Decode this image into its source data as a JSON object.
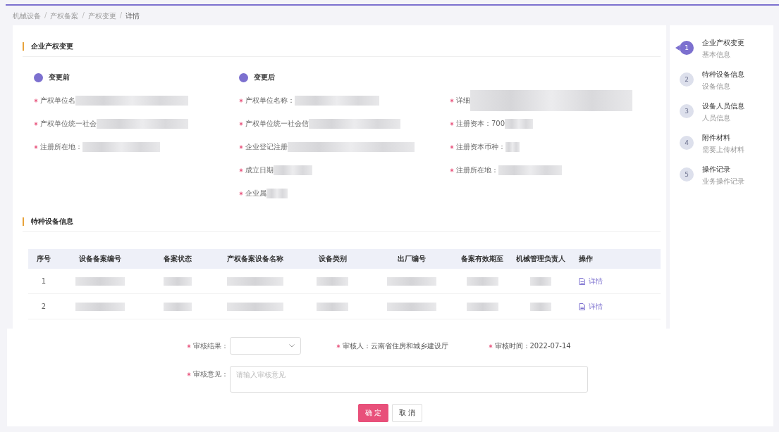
{
  "breadcrumb": [
    {
      "label": "机械设备",
      "current": false
    },
    {
      "separator": "/",
      "label": "产权备案",
      "current": false
    },
    {
      "separator": "/",
      "label": "产权变更",
      "current": false
    },
    {
      "separator": "/",
      "label": "详情",
      "current": true
    }
  ],
  "ownership_section": {
    "title": "企业产权变更",
    "before": {
      "title": "变更前",
      "fields": [
        {
          "label": "产权单位名",
          "required": true
        },
        {
          "label": "产权单位统一社会",
          "required": true
        },
        {
          "label": "注册所在地：",
          "required": true
        }
      ]
    },
    "after": {
      "title": "变更后",
      "fields": [
        {
          "label": "产权单位名称：",
          "required": true
        },
        {
          "label": "产权单位统一社会信",
          "required": true
        },
        {
          "label": "企业登记注册",
          "required": true
        },
        {
          "label": "成立日期",
          "required": true
        },
        {
          "label": "企业属",
          "required": true
        }
      ]
    },
    "after_more": {
      "fields": [
        {
          "label": "详细",
          "required": true
        },
        {
          "label": "注册资本：700",
          "required": true
        },
        {
          "label": "注册资本币种：",
          "required": true
        },
        {
          "label": "注册所在地：",
          "required": true
        }
      ]
    }
  },
  "equipment_section": {
    "title": "特种设备信息",
    "table": {
      "columns": [
        "序号",
        "设备备案编号",
        "备案状态",
        "产权备案设备名称",
        "设备类别",
        "出厂编号",
        "备案有效期至",
        "机械管理负责人",
        "操作"
      ],
      "rows": [
        {
          "index": "1",
          "action": "详情"
        },
        {
          "index": "2",
          "action": "详情"
        }
      ]
    }
  },
  "steps": [
    {
      "title": "企业产权变更",
      "subtitle": "基本信息",
      "number": "1",
      "selected": true
    },
    {
      "title": "特种设备信息",
      "subtitle": "设备信息",
      "number": "2",
      "selected": false
    },
    {
      "title": "设备人员信息",
      "subtitle": "人员信息",
      "number": "3",
      "selected": false
    },
    {
      "title": "附件材料",
      "subtitle": "需要上传材料",
      "number": "4",
      "selected": false
    },
    {
      "title": "操作记录",
      "subtitle": "业务操作记录",
      "number": "5",
      "selected": false
    }
  ],
  "review": {
    "result_label": "审核结果：",
    "reviewer_label": "审核人：",
    "reviewer": "云南省住房和城乡建设厅",
    "time_label": "审核时间：",
    "time": "2022-07-14",
    "opinion_label": "审核意见：",
    "opinion_placeholder": "请输入审核意见",
    "buttons": [
      {
        "label": "确 定",
        "kind": "primary"
      },
      {
        "label": "取 消",
        "kind": "default"
      }
    ]
  }
}
